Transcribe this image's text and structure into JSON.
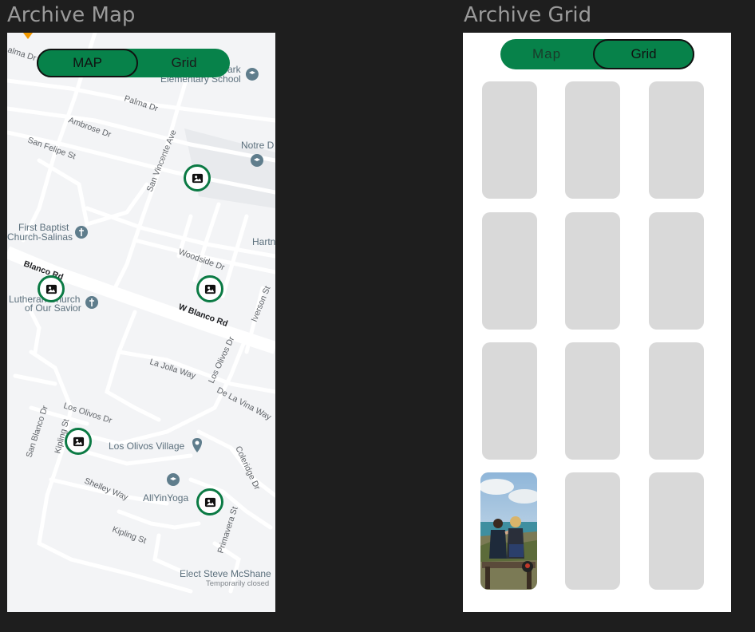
{
  "frames": {
    "map_title": "Archive Map",
    "grid_title": "Archive Grid"
  },
  "map_view": {
    "toggle": {
      "map_label": "MAP",
      "grid_label": "Grid",
      "active": "map"
    },
    "streets": {
      "palma_dr": "Palma Dr",
      "palma_dr_left": "alma Dr",
      "ambrose_dr": "Ambrose Dr",
      "san_felipe_st": "San Felipe St",
      "san_vincente_ave": "San Vincente Ave",
      "woodside_dr": "Woodside Dr",
      "blanco_rd": "Blanco Rd",
      "w_blanco_rd": "W Blanco Rd",
      "iverson_st": "Iverson St",
      "la_jolla_way": "La Jolla Way",
      "los_olivos_dr_vertical": "Los Olivos Dr",
      "de_la_vina_way": "De La Vina Way",
      "los_olivos_dr": "Los Olivos Dr",
      "san_blanco_dr": "San Blanco Dr",
      "kipling_st_vertical": "Kipling St",
      "shelley_way": "Shelley Way",
      "kipling_st": "Kipling St",
      "coleridge_dr": "Coleridge Dr",
      "primavera_st": "Primavera St"
    },
    "pois": {
      "park_school_line1": "ark",
      "park_school_line2": "Elementary School",
      "notre_d": "Notre D",
      "first_baptist_line1": "First Baptist",
      "first_baptist_line2": "Church-Salinas",
      "hartn": "Hartn",
      "lutheran_line1": "Lutheran Church",
      "lutheran_line2": "of Our Savior",
      "los_olivos_village": "Los Olivos Village",
      "allyinyoga": "AllYinYoga",
      "elect_steve": "Elect Steve McShane",
      "temporarily_closed": "Temporarily closed"
    },
    "markers_icon": "image-icon",
    "accent_color": "#07824a",
    "marker_border_color": "#0b7a44"
  },
  "grid_view": {
    "toggle": {
      "map_label": "Map",
      "grid_label": "Grid",
      "active": "grid"
    },
    "tiles": [
      {
        "type": "placeholder"
      },
      {
        "type": "placeholder"
      },
      {
        "type": "placeholder"
      },
      {
        "type": "placeholder"
      },
      {
        "type": "placeholder"
      },
      {
        "type": "placeholder"
      },
      {
        "type": "placeholder"
      },
      {
        "type": "placeholder"
      },
      {
        "type": "placeholder"
      },
      {
        "type": "photo",
        "icon": "two-friends-photo"
      },
      {
        "type": "placeholder"
      },
      {
        "type": "placeholder"
      }
    ],
    "placeholder_color": "#d9d9d9"
  }
}
